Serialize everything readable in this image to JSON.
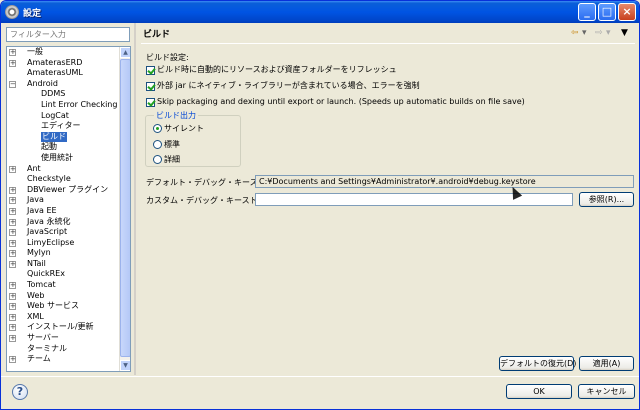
{
  "window": {
    "title": "設定"
  },
  "filter": {
    "placeholder": "フィルター入力"
  },
  "tree": [
    {
      "label": "一般",
      "level": 0,
      "expandable": true
    },
    {
      "label": "AmaterasERD",
      "level": 0,
      "expandable": true
    },
    {
      "label": "AmaterasUML",
      "level": 0,
      "expandable": false
    },
    {
      "label": "Android",
      "level": 0,
      "expandable": true,
      "expanded": true
    },
    {
      "label": "DDMS",
      "level": 1,
      "expandable": false
    },
    {
      "label": "Lint Error Checking",
      "level": 1,
      "expandable": false
    },
    {
      "label": "LogCat",
      "level": 1,
      "expandable": false
    },
    {
      "label": "エディター",
      "level": 1,
      "expandable": false
    },
    {
      "label": "ビルド",
      "level": 1,
      "expandable": false,
      "selected": true
    },
    {
      "label": "起動",
      "level": 1,
      "expandable": false
    },
    {
      "label": "使用統計",
      "level": 1,
      "expandable": false
    },
    {
      "label": "Ant",
      "level": 0,
      "expandable": true
    },
    {
      "label": "Checkstyle",
      "level": 0,
      "expandable": false
    },
    {
      "label": "DBViewer プラグイン",
      "level": 0,
      "expandable": true
    },
    {
      "label": "Java",
      "level": 0,
      "expandable": true
    },
    {
      "label": "Java EE",
      "level": 0,
      "expandable": true
    },
    {
      "label": "Java 永続化",
      "level": 0,
      "expandable": true
    },
    {
      "label": "JavaScript",
      "level": 0,
      "expandable": true
    },
    {
      "label": "LimyEclipse",
      "level": 0,
      "expandable": true
    },
    {
      "label": "Mylyn",
      "level": 0,
      "expandable": true
    },
    {
      "label": "NTail",
      "level": 0,
      "expandable": true
    },
    {
      "label": "QuickREx",
      "level": 0,
      "expandable": false
    },
    {
      "label": "Tomcat",
      "level": 0,
      "expandable": true
    },
    {
      "label": "Web",
      "level": 0,
      "expandable": true
    },
    {
      "label": "Web サービス",
      "level": 0,
      "expandable": true
    },
    {
      "label": "XML",
      "level": 0,
      "expandable": true
    },
    {
      "label": "インストール/更新",
      "level": 0,
      "expandable": true
    },
    {
      "label": "サーバー",
      "level": 0,
      "expandable": true
    },
    {
      "label": "ターミナル",
      "level": 0,
      "expandable": false
    },
    {
      "label": "チーム",
      "level": 0,
      "expandable": true
    }
  ],
  "page": {
    "title": "ビルド",
    "section_label": "ビルド設定:",
    "checkboxes": [
      {
        "label": "ビルド時に自動的にリソースおよび資産フォルダーをリフレッシュ",
        "checked": true
      },
      {
        "label": "外部 jar にネイティブ・ライブラリーが含まれている場合、エラーを強制",
        "checked": true
      },
      {
        "label": "Skip packaging and dexing until export or launch. (Speeds up automatic builds on file save)",
        "checked": true
      }
    ],
    "output_group": {
      "title": "ビルド出力",
      "options": [
        {
          "label": "サイレント",
          "selected": true
        },
        {
          "label": "標準",
          "selected": false
        },
        {
          "label": "詳細",
          "selected": false
        }
      ]
    },
    "default_keystore_label": "デフォルト・デバッグ・キーストア:",
    "default_keystore_value": "C:¥Documents and Settings¥Administrator¥.android¥debug.keystore",
    "custom_keystore_label": "カスタム・デバッグ・キーストア:",
    "custom_keystore_value": "",
    "browse_label": "参照(R)...",
    "restore_defaults_label": "デフォルトの復元(D)",
    "apply_label": "適用(A)"
  },
  "footer": {
    "ok_label": "OK",
    "cancel_label": "キャンセル"
  }
}
